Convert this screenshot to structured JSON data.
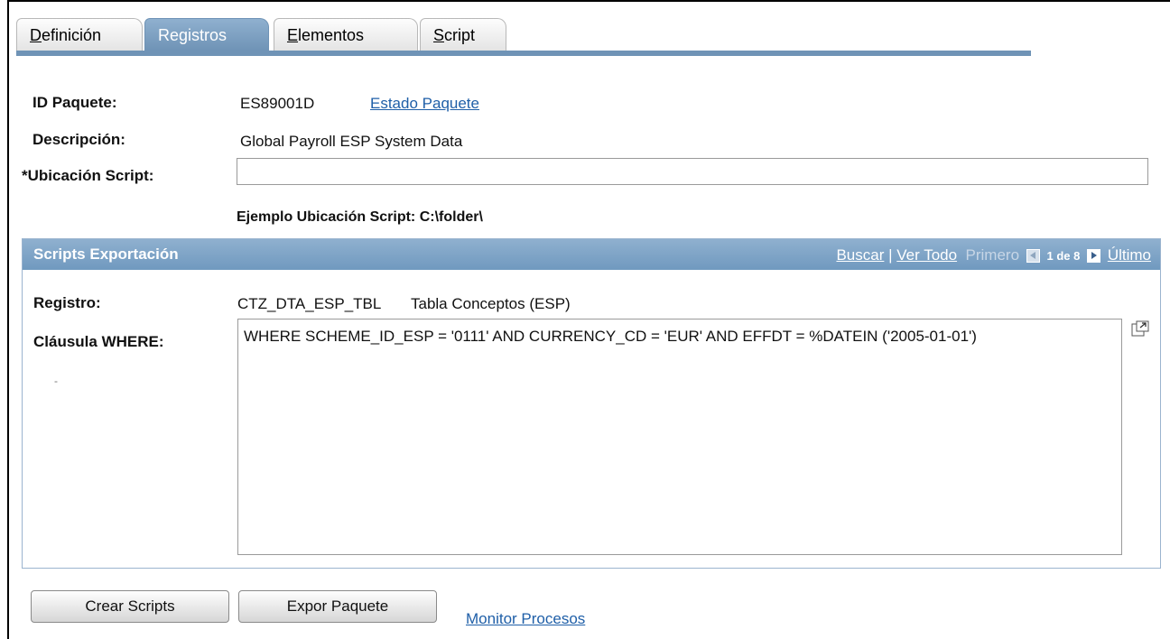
{
  "tabs": [
    {
      "label": "Definición",
      "underline": "D",
      "rest": "efinición",
      "active": false
    },
    {
      "label": "Registros",
      "active": true
    },
    {
      "label": "Elementos",
      "underline": "E",
      "rest": "lementos",
      "active": false
    },
    {
      "label": "Script",
      "underline": "S",
      "rest": "cript",
      "active": false
    }
  ],
  "header": {
    "package_id_label": "ID Paquete:",
    "package_id_value": "ES89001D",
    "package_status_link": "Estado Paquete",
    "description_label": "Descripción:",
    "description_value": "Global Payroll ESP System Data",
    "script_location_label": "*Ubicación Script:",
    "script_location_value": "",
    "script_location_example": "Ejemplo Ubicación Script: C:\\folder\\"
  },
  "section": {
    "title": "Scripts Exportación",
    "nav": {
      "find": "Buscar",
      "separator": "|",
      "view_all": "Ver Todo",
      "first": "Primero",
      "count": "1 de 8",
      "last": "Último"
    },
    "record_label": "Registro:",
    "record_value": "CTZ_DTA_ESP_TBL",
    "record_description": "Tabla Conceptos (ESP)",
    "where_label": "Cláusula WHERE:",
    "where_value": "WHERE SCHEME_ID_ESP = '0111' AND CURRENCY_CD = 'EUR' AND EFFDT = %DATEIN ('2005-01-01')",
    "dash": "-"
  },
  "footer": {
    "create_scripts": "Crear Scripts",
    "export_package": "Expor Paquete",
    "process_monitor": "Monitor Procesos"
  },
  "icons": {
    "expand": "expand-window-icon",
    "prev": "arrow-left-icon",
    "next": "arrow-right-icon"
  },
  "colors": {
    "tab_active": "#6f93b6",
    "section_header": "#7c9fc4",
    "link": "#1f5fa8"
  }
}
